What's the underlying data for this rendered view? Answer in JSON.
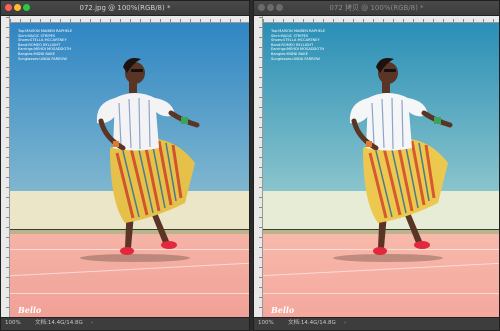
{
  "left_window": {
    "title": "072.jpg @ 100%(RGB/8) *",
    "status": {
      "zoom": "100%",
      "doc": "文档:14.4G/14.8G",
      "arrow": "›"
    }
  },
  "right_window": {
    "title": "072 拷贝 @ 100%(RGB/8) *",
    "status": {
      "zoom": "100%",
      "doc": "文档:14.4G/14.8G",
      "arrow": "›"
    }
  },
  "image": {
    "credits": "Top:MAISON MAIBEN RAPHELE\nSkirt:MAGIC STRIPES\nShoes:STELLA MCCARTNEY\nBand:ROMEO BYLLIGHT\nEarrings:MEHDI MOSADDOTH\nBangles:MIDNI BAKE\nSunglasses:LINDA FARROW",
    "logo": "Bello"
  },
  "colors": {
    "traffic_red": "#ff5f57",
    "traffic_yellow": "#febc2e",
    "traffic_green": "#28c840",
    "traffic_inactive": "#6a6a6a",
    "left_sky_top": "#2f86c4",
    "left_sky_bottom": "#7fb6cf",
    "left_wall": "#ece6c8",
    "left_floor": "#f1a197",
    "right_sky_top": "#2a8fb7",
    "right_sky_bottom": "#8ac4cc",
    "right_wall": "#e6ecd6",
    "right_floor": "#f4a79d"
  }
}
